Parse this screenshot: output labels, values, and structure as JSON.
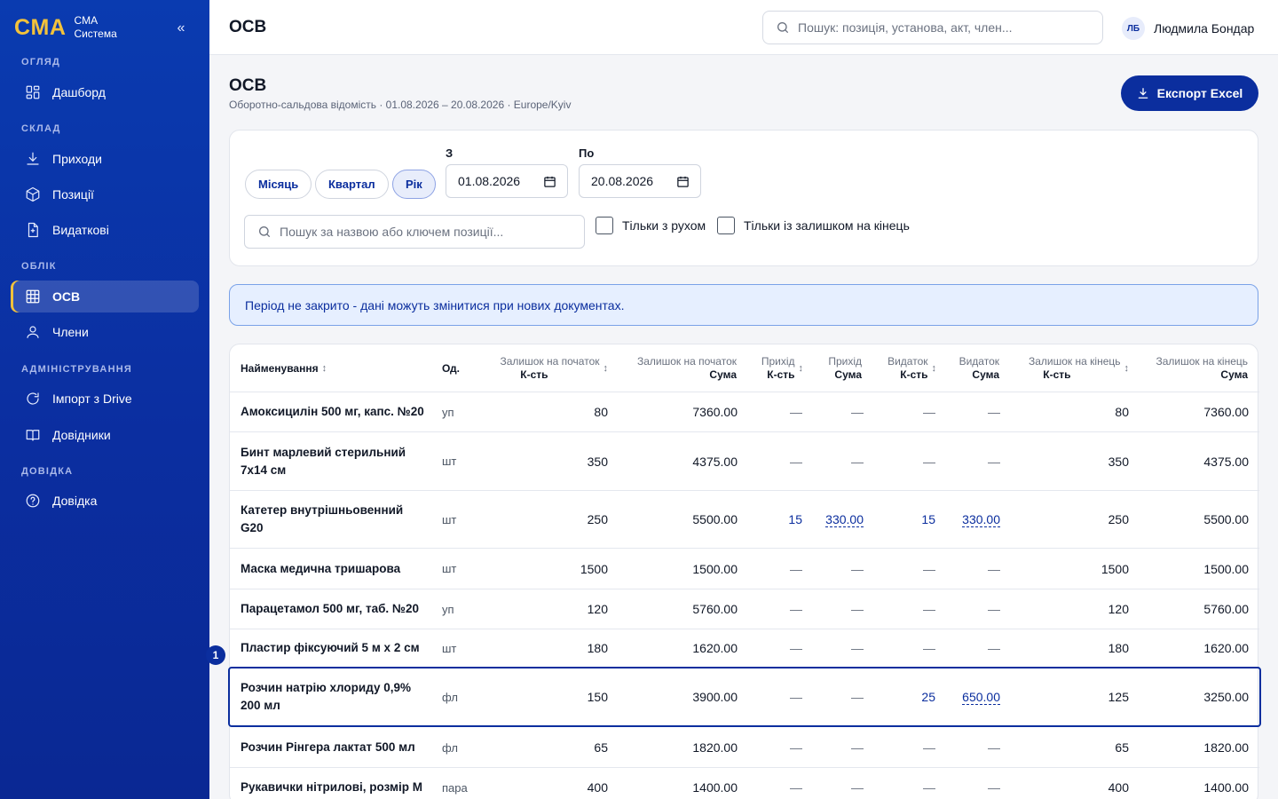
{
  "app": {
    "logo": "CMA",
    "name_line1": "CMA",
    "name_line2": "Система",
    "collapse_glyph": "«"
  },
  "sidebar": {
    "sections": [
      {
        "label": "ОГЛЯД"
      },
      {
        "label": "СКЛАД"
      },
      {
        "label": "ОБЛІК"
      },
      {
        "label": "АДМІНІСТРУВАННЯ"
      },
      {
        "label": "ДОВІДКА"
      }
    ],
    "items": [
      {
        "label": "Дашборд",
        "icon": "dashboard-icon"
      },
      {
        "label": "Приходи",
        "icon": "download-icon"
      },
      {
        "label": "Позиції",
        "icon": "box-icon"
      },
      {
        "label": "Видаткові",
        "icon": "document-icon"
      },
      {
        "label": "ОСВ",
        "icon": "table-icon",
        "active": true
      },
      {
        "label": "Члени",
        "icon": "user-icon"
      },
      {
        "label": "Імпорт з Drive",
        "icon": "sync-icon"
      },
      {
        "label": "Довідники",
        "icon": "book-icon"
      },
      {
        "label": "Довідка",
        "icon": "help-icon"
      }
    ]
  },
  "topbar": {
    "title": "ОСВ",
    "search_placeholder": "Пошук: позиція, установа, акт, член...",
    "user_initials": "ЛБ",
    "user_name": "Людмила Бондар"
  },
  "page": {
    "title": "ОСВ",
    "subtitle": "Оборотно-сальдова відомість · 01.08.2026 – 20.08.2026 · Europe/Kyiv",
    "export_label": "Експорт Excel"
  },
  "filters": {
    "periods": [
      "Місяць",
      "Квартал",
      "Рік"
    ],
    "active_period": "Рік",
    "from_label": "З",
    "from_value": "01.08.2026",
    "to_label": "По",
    "to_value": "20.08.2026",
    "search_placeholder": "Пошук за назвою або ключем позиції...",
    "only_movement_label": "Тільки з рухом",
    "only_balance_label": "Тільки із залишком на кінець"
  },
  "notice": {
    "text": "Період не закрито - дані можуть змінитися при нових документах."
  },
  "table": {
    "columns": [
      {
        "sub": "",
        "main": "Найменування",
        "sortable": true
      },
      {
        "sub": "",
        "main": "Од.",
        "sortable": false
      },
      {
        "sub": "Залишок на початок",
        "main": "К-сть",
        "sortable": true
      },
      {
        "sub": "Залишок на початок",
        "main": "Сума",
        "sortable": false
      },
      {
        "sub": "Прихід",
        "main": "К-сть",
        "sortable": true
      },
      {
        "sub": "Прихід",
        "main": "Сума",
        "sortable": false
      },
      {
        "sub": "Видаток",
        "main": "К-сть",
        "sortable": true
      },
      {
        "sub": "Видаток",
        "main": "Сума",
        "sortable": false
      },
      {
        "sub": "Залишок на кінець",
        "main": "К-сть",
        "sortable": true
      },
      {
        "sub": "Залишок на кінець",
        "main": "Сума",
        "sortable": false
      }
    ],
    "rows": [
      {
        "name": "Амоксицилін 500 мг, капс. №20",
        "unit": "уп",
        "open_qty": "80",
        "open_sum": "7360.00",
        "in_qty": "—",
        "in_sum": "—",
        "out_qty": "—",
        "out_sum": "—",
        "close_qty": "80",
        "close_sum": "7360.00"
      },
      {
        "name": "Бинт марлевий стерильний 7х14 см",
        "unit": "шт",
        "open_qty": "350",
        "open_sum": "4375.00",
        "in_qty": "—",
        "in_sum": "—",
        "out_qty": "—",
        "out_sum": "—",
        "close_qty": "350",
        "close_sum": "4375.00"
      },
      {
        "name": "Катетер внутрішньовенний G20",
        "unit": "шт",
        "open_qty": "250",
        "open_sum": "5500.00",
        "in_qty": "15",
        "in_sum": "330.00",
        "out_qty": "15",
        "out_sum": "330.00",
        "close_qty": "250",
        "close_sum": "5500.00"
      },
      {
        "name": "Маска медична тришарова",
        "unit": "шт",
        "open_qty": "1500",
        "open_sum": "1500.00",
        "in_qty": "—",
        "in_sum": "—",
        "out_qty": "—",
        "out_sum": "—",
        "close_qty": "1500",
        "close_sum": "1500.00"
      },
      {
        "name": "Парацетамол 500 мг, таб. №20",
        "unit": "уп",
        "open_qty": "120",
        "open_sum": "5760.00",
        "in_qty": "—",
        "in_sum": "—",
        "out_qty": "—",
        "out_sum": "—",
        "close_qty": "120",
        "close_sum": "5760.00"
      },
      {
        "name": "Пластир фіксуючий 5 м х 2 см",
        "unit": "шт",
        "open_qty": "180",
        "open_sum": "1620.00",
        "in_qty": "—",
        "in_sum": "—",
        "out_qty": "—",
        "out_sum": "—",
        "close_qty": "180",
        "close_sum": "1620.00"
      },
      {
        "name": "Розчин натрію хлориду 0,9% 200 мл",
        "unit": "фл",
        "open_qty": "150",
        "open_sum": "3900.00",
        "in_qty": "—",
        "in_sum": "—",
        "out_qty": "25",
        "out_sum": "650.00",
        "close_qty": "125",
        "close_sum": "3250.00",
        "selected": true
      },
      {
        "name": "Розчин Рінгера лактат 500 мл",
        "unit": "фл",
        "open_qty": "65",
        "open_sum": "1820.00",
        "in_qty": "—",
        "in_sum": "—",
        "out_qty": "—",
        "out_sum": "—",
        "close_qty": "65",
        "close_sum": "1820.00"
      },
      {
        "name": "Рукавички нітрилові, розмір M",
        "unit": "пара",
        "open_qty": "400",
        "open_sum": "1400.00",
        "in_qty": "—",
        "in_sum": "—",
        "out_qty": "—",
        "out_sum": "—",
        "close_qty": "400",
        "close_sum": "1400.00"
      }
    ],
    "selected_badge": "1"
  },
  "colors": {
    "brand_blue": "#0b2e9e",
    "sidebar_blue": "#0a3bb0",
    "logo_yellow": "#f3c23b",
    "notice_bg": "#e6efff"
  }
}
